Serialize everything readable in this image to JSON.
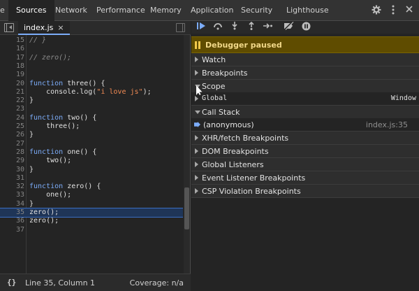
{
  "tabs": [
    {
      "label": "e"
    },
    {
      "label": "Sources"
    },
    {
      "label": "Network"
    },
    {
      "label": "Performance"
    },
    {
      "label": "Memory"
    },
    {
      "label": "Application"
    },
    {
      "label": "Security"
    },
    {
      "label": "Lighthouse"
    }
  ],
  "toolbar_icons": [
    "gear-icon",
    "kebab-menu-icon",
    "close-icon"
  ],
  "editor": {
    "filename": "index.js",
    "close_glyph": "×",
    "lines": [
      {
        "n": "15",
        "text": "// }"
      },
      {
        "n": "16",
        "text": ""
      },
      {
        "n": "17",
        "text": "// zero();"
      },
      {
        "n": "18",
        "text": ""
      },
      {
        "n": "19",
        "text": ""
      },
      {
        "n": "20",
        "text": "function three() {"
      },
      {
        "n": "21",
        "text": "    console.log(\"i love js\");"
      },
      {
        "n": "22",
        "text": "}"
      },
      {
        "n": "23",
        "text": ""
      },
      {
        "n": "24",
        "text": "function two() {"
      },
      {
        "n": "25",
        "text": "    three();"
      },
      {
        "n": "26",
        "text": "}"
      },
      {
        "n": "27",
        "text": ""
      },
      {
        "n": "28",
        "text": "function one() {"
      },
      {
        "n": "29",
        "text": "    two();"
      },
      {
        "n": "30",
        "text": "}"
      },
      {
        "n": "31",
        "text": ""
      },
      {
        "n": "32",
        "text": "function zero() {"
      },
      {
        "n": "33",
        "text": "    one();"
      },
      {
        "n": "34",
        "text": "}"
      },
      {
        "n": "35",
        "text": "zero();"
      },
      {
        "n": "36",
        "text": "zero();"
      },
      {
        "n": "37",
        "text": ""
      }
    ],
    "highlight_line": "35"
  },
  "status": {
    "braces": "{}",
    "position": "Line 35, Column 1",
    "coverage": "Coverage: n/a"
  },
  "debugger": {
    "paused_label": "Debugger paused",
    "sections": {
      "watch": "Watch",
      "breakpoints": "Breakpoints",
      "scope": "Scope",
      "call_stack": "Call Stack",
      "xhr": "XHR/fetch Breakpoints",
      "dom": "DOM Breakpoints",
      "global_listeners": "Global Listeners",
      "event_listener": "Event Listener Breakpoints",
      "csp": "CSP Violation Breakpoints"
    },
    "scope_global": {
      "name": "Global",
      "value": "Window"
    },
    "frame": {
      "name": "(anonymous)",
      "location": "index.js:35"
    }
  },
  "colors": {
    "accent_blue": "#7cacf8",
    "paused_bg": "#5f4c00",
    "paused_text": "#f2d98a",
    "string": "#f28b54"
  }
}
